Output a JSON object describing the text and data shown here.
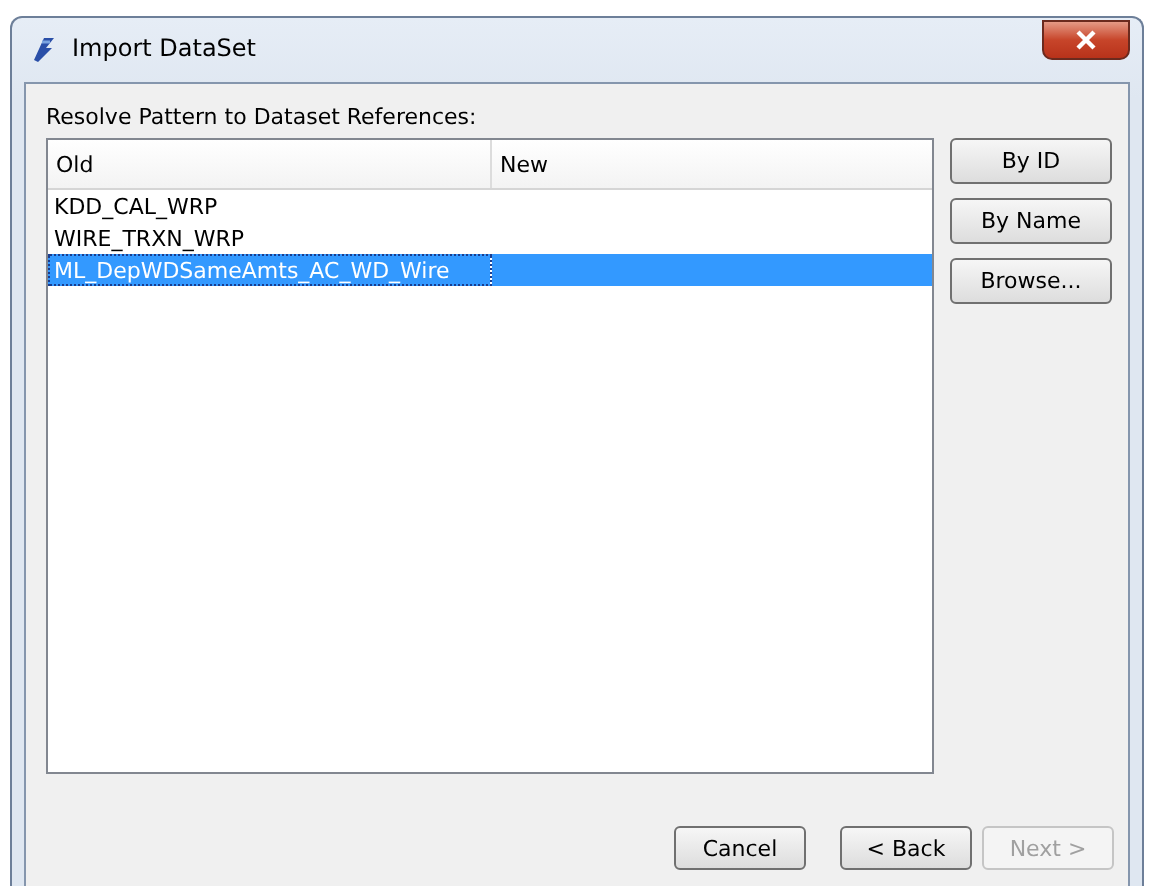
{
  "window": {
    "title": "Import DataSet"
  },
  "prompt": "Resolve Pattern to Dataset References:",
  "table": {
    "columns": [
      "Old",
      "New"
    ],
    "rows": [
      {
        "old": "KDD_CAL_WRP",
        "selected": false
      },
      {
        "old": "WIRE_TRXN_WRP",
        "selected": false
      },
      {
        "old": "ML_DepWDSameAmts_AC_WD_Wire",
        "selected": true
      }
    ]
  },
  "side_buttons": [
    {
      "label": "By ID",
      "disabled": false
    },
    {
      "label": "By Name",
      "disabled": false
    },
    {
      "label": "Browse...",
      "disabled": false
    }
  ],
  "footer_buttons": [
    {
      "label": "Cancel",
      "disabled": false
    },
    {
      "label": "< Back",
      "disabled": false
    },
    {
      "label": "Next >",
      "disabled": true
    }
  ]
}
